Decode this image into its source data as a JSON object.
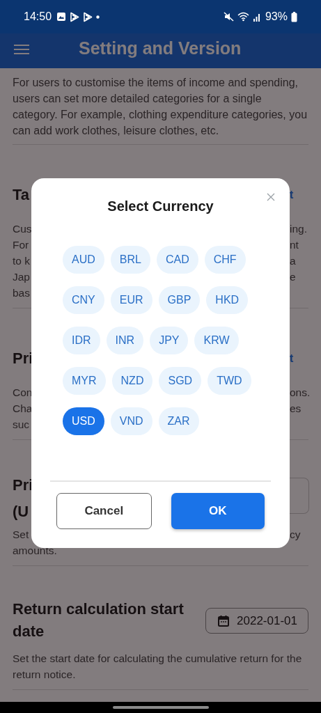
{
  "status_bar": {
    "time": "14:50",
    "battery": "93%"
  },
  "app_bar": {
    "title": "Setting and Version"
  },
  "intro": {
    "description": "For users to customise the items of income and spending, users can set more detailed categories for a single category. For example, clothing expenditure categories, you can add work clothes, leisure clothes, etc."
  },
  "sections": [
    {
      "kind": "link",
      "title": "Ta",
      "action": "t",
      "lines": [
        {
          "left": "Cus",
          "right": "ing."
        },
        {
          "left": "For",
          "right": "nt"
        },
        {
          "left": "to k",
          "right": "a"
        },
        {
          "left": "Jap",
          "right": "e"
        },
        {
          "left": "bas"
        }
      ]
    },
    {
      "kind": "link",
      "title": "Pri",
      "action": "t",
      "lines": [
        {
          "left": "Con",
          "right": "ons."
        },
        {
          "left": "Cha",
          "right": "es"
        },
        {
          "left": "suc"
        }
      ]
    },
    {
      "kind": "value",
      "title_lines": [
        "Pri",
        "(U"
      ],
      "lines": [
        {
          "left": "Set",
          "right": "cy"
        },
        {
          "left": "amounts."
        }
      ]
    },
    {
      "kind": "date",
      "title": "Return calculation start date",
      "value": "2022-01-01",
      "description": "Set the start date for calculating the cumulative return for the return notice."
    }
  ],
  "dialog": {
    "title": "Select Currency",
    "currencies": [
      {
        "code": "AUD",
        "selected": false
      },
      {
        "code": "BRL",
        "selected": false
      },
      {
        "code": "CAD",
        "selected": false
      },
      {
        "code": "CHF",
        "selected": false
      },
      {
        "code": "CNY",
        "selected": false
      },
      {
        "code": "EUR",
        "selected": false
      },
      {
        "code": "GBP",
        "selected": false
      },
      {
        "code": "HKD",
        "selected": false
      },
      {
        "code": "IDR",
        "selected": false
      },
      {
        "code": "INR",
        "selected": false
      },
      {
        "code": "JPY",
        "selected": false
      },
      {
        "code": "KRW",
        "selected": false
      },
      {
        "code": "MYR",
        "selected": false
      },
      {
        "code": "NZD",
        "selected": false
      },
      {
        "code": "SGD",
        "selected": false
      },
      {
        "code": "TWD",
        "selected": false
      },
      {
        "code": "USD",
        "selected": true
      },
      {
        "code": "VND",
        "selected": false
      },
      {
        "code": "ZAR",
        "selected": false
      }
    ],
    "cancel": "Cancel",
    "ok": "OK"
  }
}
